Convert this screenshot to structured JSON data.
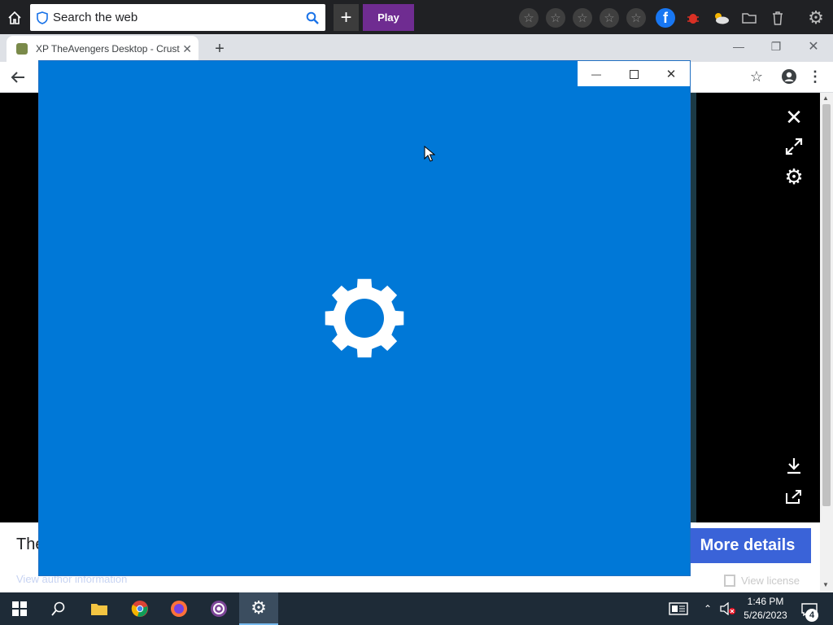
{
  "toolbar": {
    "search_placeholder": "Search the web",
    "play_label": "Play",
    "add_glyph": "+"
  },
  "browser": {
    "tab_title": "XP TheAvengers Desktop - Crust",
    "new_tab_glyph": "+"
  },
  "page": {
    "heading_fragment": "The",
    "more_details_label": "More details",
    "view_author_label": "View author information",
    "view_license_label": "View license"
  },
  "settings_window": {
    "icon": "gear-icon"
  },
  "taskbar": {
    "time": "1:46 PM",
    "date": "5/26/2023",
    "notification_count": "4"
  },
  "colors": {
    "window_blue": "#0078d7",
    "play_purple": "#6f2c91",
    "more_details_blue": "#3a63d8",
    "taskbar": "#1e2b37"
  }
}
